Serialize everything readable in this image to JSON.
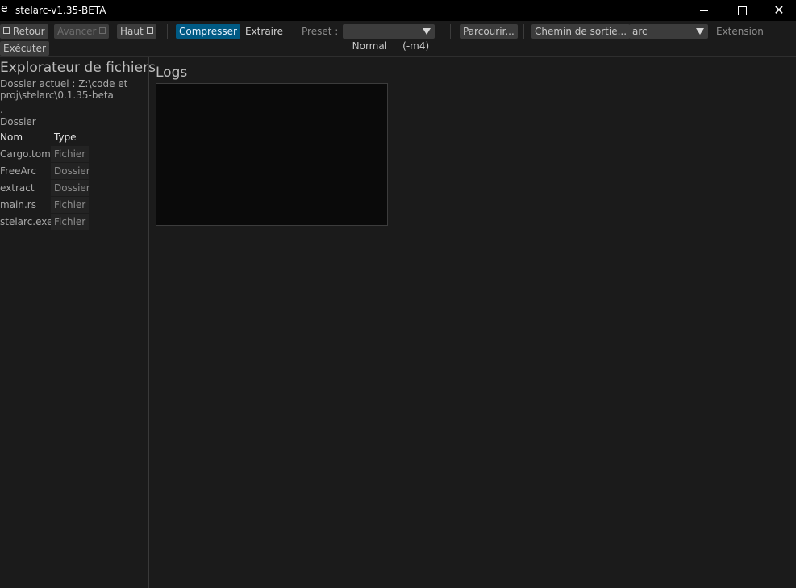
{
  "window": {
    "app_icon_glyph": "e",
    "title": "stelarc-v1.35-BETA"
  },
  "toolbar": {
    "back_label": "Retour",
    "forward_label": "Avancer",
    "up_label": "Haut",
    "compress_label": "Compresser",
    "extract_label": "Extraire",
    "preset_label": "Preset :",
    "preset_value": "Normal     (-m4)",
    "browse_label": "Parcourir...",
    "output_label": "Chemin de sortie...",
    "extension_value": "arc",
    "extension_label": "Extension",
    "execute_label": "Exécuter"
  },
  "explorer": {
    "title": "Explorateur de fichiers",
    "current_dir": "Dossier actuel : Z:\\code et proj\\stelarc\\0.1.35-beta",
    "parent": ".",
    "parent_type": "Dossier",
    "col_name": "Nom",
    "col_type": "Type",
    "files": [
      {
        "name": "Cargo.toml",
        "type": "Fichier"
      },
      {
        "name": "FreeArc",
        "type": "Dossier"
      },
      {
        "name": "extract",
        "type": "Dossier"
      },
      {
        "name": "main.rs",
        "type": "Fichier"
      },
      {
        "name": "stelarc.exe",
        "type": "Fichier"
      }
    ]
  },
  "logs": {
    "title": "Logs"
  },
  "colors": {
    "accent": "#005a84",
    "background": "#1b1b1b",
    "titlebar": "#000000"
  },
  "icons": [
    "checkbox-icon",
    "chevron-down-icon",
    "minimize-icon",
    "maximize-icon",
    "close-icon"
  ]
}
